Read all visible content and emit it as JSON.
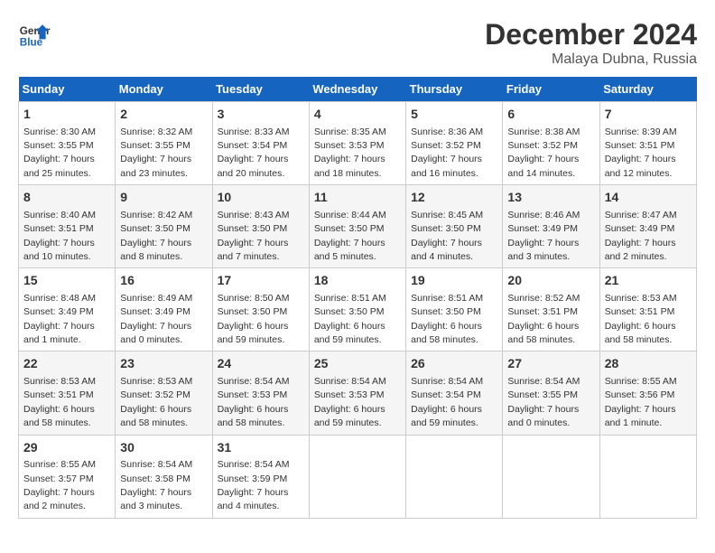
{
  "logo": {
    "line1": "General",
    "line2": "Blue"
  },
  "title": "December 2024",
  "location": "Malaya Dubna, Russia",
  "weekdays": [
    "Sunday",
    "Monday",
    "Tuesday",
    "Wednesday",
    "Thursday",
    "Friday",
    "Saturday"
  ],
  "weeks": [
    [
      {
        "day": "1",
        "sunrise": "Sunrise: 8:30 AM",
        "sunset": "Sunset: 3:55 PM",
        "daylight": "Daylight: 7 hours and 25 minutes."
      },
      {
        "day": "2",
        "sunrise": "Sunrise: 8:32 AM",
        "sunset": "Sunset: 3:55 PM",
        "daylight": "Daylight: 7 hours and 23 minutes."
      },
      {
        "day": "3",
        "sunrise": "Sunrise: 8:33 AM",
        "sunset": "Sunset: 3:54 PM",
        "daylight": "Daylight: 7 hours and 20 minutes."
      },
      {
        "day": "4",
        "sunrise": "Sunrise: 8:35 AM",
        "sunset": "Sunset: 3:53 PM",
        "daylight": "Daylight: 7 hours and 18 minutes."
      },
      {
        "day": "5",
        "sunrise": "Sunrise: 8:36 AM",
        "sunset": "Sunset: 3:52 PM",
        "daylight": "Daylight: 7 hours and 16 minutes."
      },
      {
        "day": "6",
        "sunrise": "Sunrise: 8:38 AM",
        "sunset": "Sunset: 3:52 PM",
        "daylight": "Daylight: 7 hours and 14 minutes."
      },
      {
        "day": "7",
        "sunrise": "Sunrise: 8:39 AM",
        "sunset": "Sunset: 3:51 PM",
        "daylight": "Daylight: 7 hours and 12 minutes."
      }
    ],
    [
      {
        "day": "8",
        "sunrise": "Sunrise: 8:40 AM",
        "sunset": "Sunset: 3:51 PM",
        "daylight": "Daylight: 7 hours and 10 minutes."
      },
      {
        "day": "9",
        "sunrise": "Sunrise: 8:42 AM",
        "sunset": "Sunset: 3:50 PM",
        "daylight": "Daylight: 7 hours and 8 minutes."
      },
      {
        "day": "10",
        "sunrise": "Sunrise: 8:43 AM",
        "sunset": "Sunset: 3:50 PM",
        "daylight": "Daylight: 7 hours and 7 minutes."
      },
      {
        "day": "11",
        "sunrise": "Sunrise: 8:44 AM",
        "sunset": "Sunset: 3:50 PM",
        "daylight": "Daylight: 7 hours and 5 minutes."
      },
      {
        "day": "12",
        "sunrise": "Sunrise: 8:45 AM",
        "sunset": "Sunset: 3:50 PM",
        "daylight": "Daylight: 7 hours and 4 minutes."
      },
      {
        "day": "13",
        "sunrise": "Sunrise: 8:46 AM",
        "sunset": "Sunset: 3:49 PM",
        "daylight": "Daylight: 7 hours and 3 minutes."
      },
      {
        "day": "14",
        "sunrise": "Sunrise: 8:47 AM",
        "sunset": "Sunset: 3:49 PM",
        "daylight": "Daylight: 7 hours and 2 minutes."
      }
    ],
    [
      {
        "day": "15",
        "sunrise": "Sunrise: 8:48 AM",
        "sunset": "Sunset: 3:49 PM",
        "daylight": "Daylight: 7 hours and 1 minute."
      },
      {
        "day": "16",
        "sunrise": "Sunrise: 8:49 AM",
        "sunset": "Sunset: 3:49 PM",
        "daylight": "Daylight: 7 hours and 0 minutes."
      },
      {
        "day": "17",
        "sunrise": "Sunrise: 8:50 AM",
        "sunset": "Sunset: 3:50 PM",
        "daylight": "Daylight: 6 hours and 59 minutes."
      },
      {
        "day": "18",
        "sunrise": "Sunrise: 8:51 AM",
        "sunset": "Sunset: 3:50 PM",
        "daylight": "Daylight: 6 hours and 59 minutes."
      },
      {
        "day": "19",
        "sunrise": "Sunrise: 8:51 AM",
        "sunset": "Sunset: 3:50 PM",
        "daylight": "Daylight: 6 hours and 58 minutes."
      },
      {
        "day": "20",
        "sunrise": "Sunrise: 8:52 AM",
        "sunset": "Sunset: 3:51 PM",
        "daylight": "Daylight: 6 hours and 58 minutes."
      },
      {
        "day": "21",
        "sunrise": "Sunrise: 8:53 AM",
        "sunset": "Sunset: 3:51 PM",
        "daylight": "Daylight: 6 hours and 58 minutes."
      }
    ],
    [
      {
        "day": "22",
        "sunrise": "Sunrise: 8:53 AM",
        "sunset": "Sunset: 3:51 PM",
        "daylight": "Daylight: 6 hours and 58 minutes."
      },
      {
        "day": "23",
        "sunrise": "Sunrise: 8:53 AM",
        "sunset": "Sunset: 3:52 PM",
        "daylight": "Daylight: 6 hours and 58 minutes."
      },
      {
        "day": "24",
        "sunrise": "Sunrise: 8:54 AM",
        "sunset": "Sunset: 3:53 PM",
        "daylight": "Daylight: 6 hours and 58 minutes."
      },
      {
        "day": "25",
        "sunrise": "Sunrise: 8:54 AM",
        "sunset": "Sunset: 3:53 PM",
        "daylight": "Daylight: 6 hours and 59 minutes."
      },
      {
        "day": "26",
        "sunrise": "Sunrise: 8:54 AM",
        "sunset": "Sunset: 3:54 PM",
        "daylight": "Daylight: 6 hours and 59 minutes."
      },
      {
        "day": "27",
        "sunrise": "Sunrise: 8:54 AM",
        "sunset": "Sunset: 3:55 PM",
        "daylight": "Daylight: 7 hours and 0 minutes."
      },
      {
        "day": "28",
        "sunrise": "Sunrise: 8:55 AM",
        "sunset": "Sunset: 3:56 PM",
        "daylight": "Daylight: 7 hours and 1 minute."
      }
    ],
    [
      {
        "day": "29",
        "sunrise": "Sunrise: 8:55 AM",
        "sunset": "Sunset: 3:57 PM",
        "daylight": "Daylight: 7 hours and 2 minutes."
      },
      {
        "day": "30",
        "sunrise": "Sunrise: 8:54 AM",
        "sunset": "Sunset: 3:58 PM",
        "daylight": "Daylight: 7 hours and 3 minutes."
      },
      {
        "day": "31",
        "sunrise": "Sunrise: 8:54 AM",
        "sunset": "Sunset: 3:59 PM",
        "daylight": "Daylight: 7 hours and 4 minutes."
      },
      null,
      null,
      null,
      null
    ]
  ]
}
